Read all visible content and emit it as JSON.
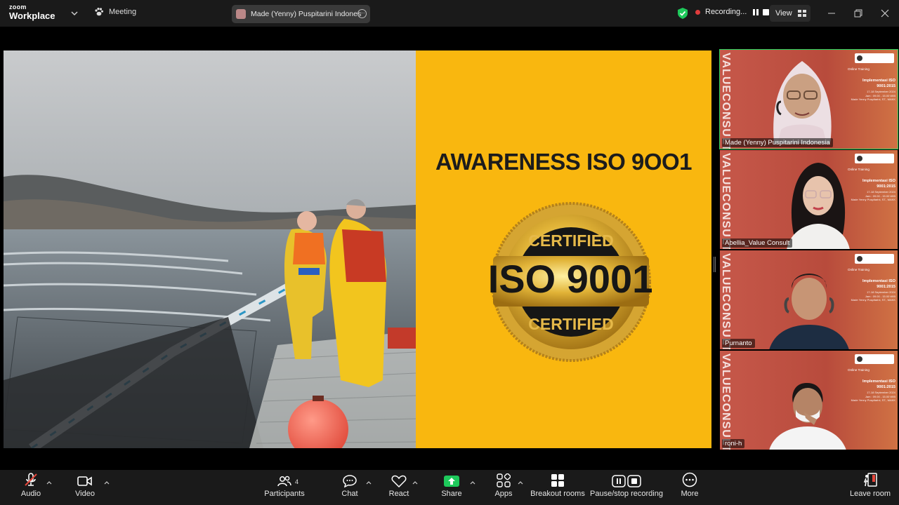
{
  "app": {
    "logo_line1": "zoom",
    "logo_line2": "Workplace"
  },
  "topbar": {
    "meeting_label": "Meeting",
    "active_speaker": "Made (Yenny) Puspitarini Indonesia",
    "recording_label": "Recording...",
    "view_label": "View"
  },
  "slide": {
    "title": "AWARENESS ISO 9OO1",
    "seal_top": "CERTIFIED",
    "seal_center": "ISO 9001",
    "seal_bottom": "CERTIFIED"
  },
  "participants_gallery": [
    {
      "name": "Made (Yenny) Puspitarini Indonesia",
      "active": true
    },
    {
      "name": "Abellia_Value Consult",
      "active": false
    },
    {
      "name": "Purnanto",
      "active": false
    },
    {
      "name": "roni-h",
      "active": false
    }
  ],
  "virtual_background": {
    "vertical_text": "VALUECONSULT",
    "online_training": "Online Training",
    "program": "Implementasi ISO 9001:2015",
    "dates": "17-18 September 2024",
    "time": "Jam : 09.00 - 15.00 WIB",
    "trainer": "Made Yenny Puspitarini, ST., MAKK"
  },
  "toolbar": {
    "audio": "Audio",
    "video": "Video",
    "participants": "Participants",
    "participants_count": "4",
    "chat": "Chat",
    "react": "React",
    "share": "Share",
    "apps": "Apps",
    "breakout": "Breakout rooms",
    "recording": "Pause/stop recording",
    "more": "More",
    "leave": "Leave room"
  },
  "colors": {
    "accent_green": "#23d961",
    "slide_yellow": "#f9b70f",
    "share_green": "#1ec95b",
    "toolbar_bg": "#1a1a1a"
  }
}
